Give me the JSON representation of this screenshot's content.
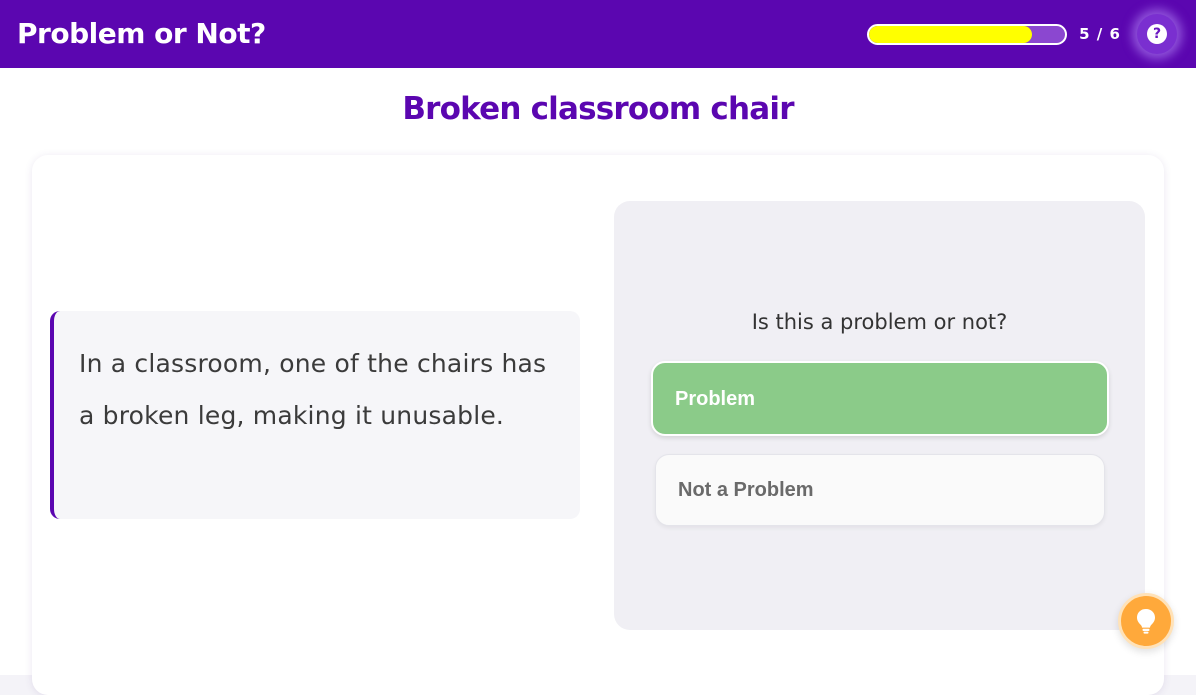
{
  "app": {
    "title": "Problem or Not?"
  },
  "progress": {
    "current": 5,
    "total": 6,
    "label": "5 / 6",
    "fill_fraction": 0.83,
    "fill_color": "#ffff00"
  },
  "header": {
    "help_icon": "question-icon",
    "help_glyph": "?"
  },
  "page": {
    "title": "Broken classroom chair"
  },
  "scenario": {
    "text": "In a classroom, one of the chairs has a broken leg, making it unusable."
  },
  "question": {
    "prompt": "Is this a problem or not?",
    "options": [
      {
        "label": "Problem",
        "state": "selected"
      },
      {
        "label": "Not a Problem",
        "state": "default"
      }
    ]
  },
  "hint": {
    "icon": "lightbulb-icon"
  },
  "colors": {
    "brand_purple": "#5b06b0",
    "selected_green": "#8bcb89",
    "hint_orange": "#ffa93b",
    "progress_yellow": "#ffff00"
  }
}
